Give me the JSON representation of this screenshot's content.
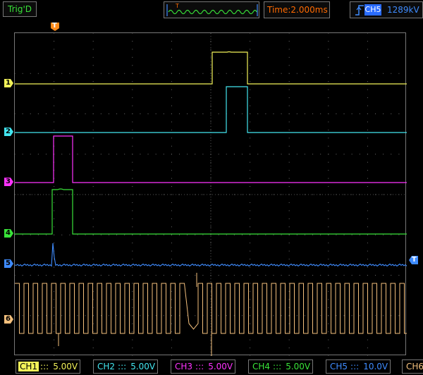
{
  "status": {
    "label": "Trig'D"
  },
  "timebase": {
    "label": "Time:2.000ms"
  },
  "trigger": {
    "channel": "CH5",
    "level": "1289kV",
    "edge": "rising-edge-icon",
    "marker": "T"
  },
  "channels": [
    {
      "id": "1",
      "name": "CH1",
      "scale": "5.00V",
      "color": "#f2f259"
    },
    {
      "id": "2",
      "name": "CH2",
      "scale": "5.00V",
      "color": "#43e6f0"
    },
    {
      "id": "3",
      "name": "CH3",
      "scale": "5.00V",
      "color": "#ff33ff"
    },
    {
      "id": "4",
      "name": "CH4",
      "scale": "5.00V",
      "color": "#39e339"
    },
    {
      "id": "5",
      "name": "CH5",
      "scale": "10.0V",
      "color": "#3f8cff"
    },
    {
      "id": "6",
      "name": "CH6",
      "scale": "",
      "color": "#f4c07d"
    }
  ],
  "coupling_symbol": ":::",
  "colors": {
    "grid": "#6a6a6a",
    "border": "#777777",
    "status": "#39e339",
    "timebase": "#ff6a00"
  }
}
